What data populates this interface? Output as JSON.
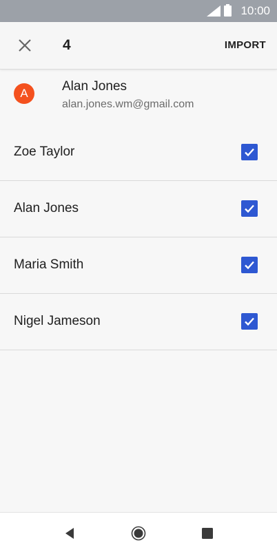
{
  "status_bar": {
    "time": "10:00",
    "icons": [
      "cell-signal-icon",
      "battery-icon"
    ]
  },
  "app_bar": {
    "close_icon": "close-icon",
    "selected_count": "4",
    "action_label": "IMPORT"
  },
  "account": {
    "avatar_letter": "A",
    "avatar_color": "#f4511e",
    "name": "Alan Jones",
    "email": "alan.jones.wm@gmail.com"
  },
  "contacts": [
    {
      "name": "Zoe Taylor",
      "checked": true
    },
    {
      "name": "Alan Jones",
      "checked": true
    },
    {
      "name": "Maria Smith",
      "checked": true
    },
    {
      "name": "Nigel Jameson",
      "checked": true
    }
  ],
  "checkbox_color": "#2e58d2",
  "nav_bar": {
    "icons": [
      "back-icon",
      "home-icon",
      "recents-icon"
    ]
  }
}
